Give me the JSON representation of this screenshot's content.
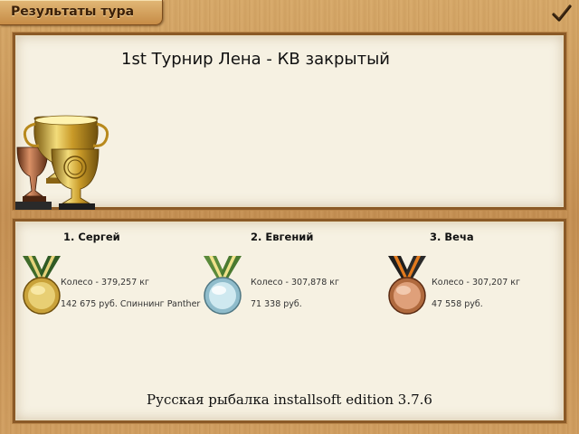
{
  "tab": {
    "label": "Результаты тура"
  },
  "confirm": {
    "icon": "checkmark-icon"
  },
  "tournament": {
    "title": "1st Турнир Лена - КВ закрытый",
    "image": "trophy-cups-image"
  },
  "places": [
    {
      "rank_name": "1. Сергей",
      "fish": "Колесо - 379,257 кг",
      "prize": "142 675 руб. Спиннинг Panther",
      "medal": "gold-medal-icon",
      "color": "#d8b24a"
    },
    {
      "rank_name": "2. Евгений",
      "fish": "Колесо - 307,878 кг",
      "prize": "71 338 руб.",
      "medal": "silver-medal-icon",
      "color": "#a9d6e3"
    },
    {
      "rank_name": "3. Веча",
      "fish": "Колесо - 307,207 кг",
      "prize": "47 558 руб.",
      "medal": "bronze-medal-icon",
      "color": "#c9804f"
    }
  ],
  "footer": {
    "text": "Русская рыбалка installsoft edition 3.7.6"
  }
}
